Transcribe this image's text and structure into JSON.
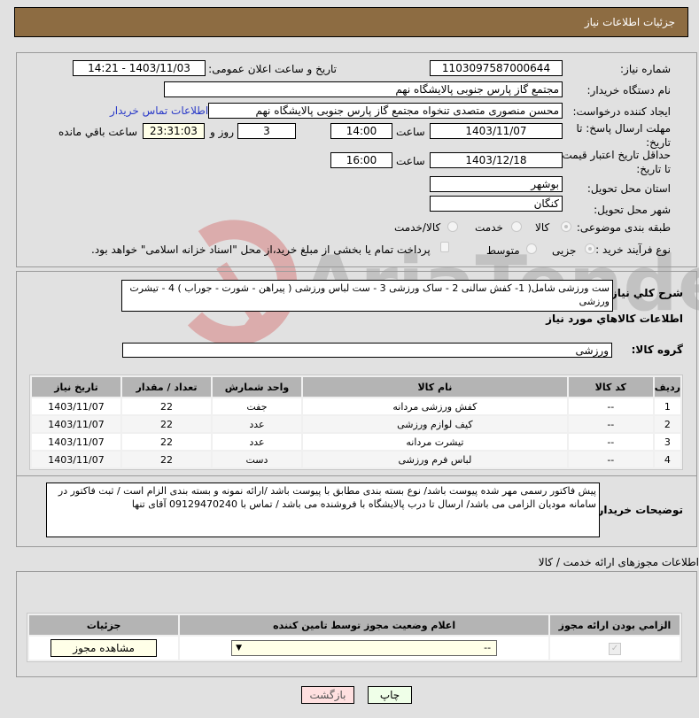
{
  "header": {
    "title": "جزئیات اطلاعات نیاز"
  },
  "form": {
    "need_number_label": "شماره نیاز:",
    "need_number": "1103097587000644",
    "announce_label": "تاریخ و ساعت اعلان عمومی:",
    "announce_value": "1403/11/03 - 14:21",
    "buyer_org_label": "نام دستگاه خریدار:",
    "buyer_org": "مجتمع گاز پارس جنوبی  پالایشگاه نهم",
    "creator_label": "ایجاد کننده درخواست:",
    "creator": "محسن منصوری متصدی تنخواه مجتمع گاز پارس جنوبی  پالایشگاه نهم",
    "contact_link": "اطلاعات تماس خریدار",
    "reply_deadline_label": "مهلت ارسال پاسخ: تا تاریخ:",
    "reply_date": "1403/11/07",
    "time_label": "ساعت",
    "reply_time": "14:00",
    "days_value": "3",
    "days_label": "روز و",
    "remaining_time": "23:31:03",
    "remaining_label": "ساعت باقي مانده",
    "price_validity_label": "حداقل تاریخ اعتبار قیمت: تا تاریخ:",
    "price_date": "1403/12/18",
    "price_time": "16:00",
    "province_label": "استان محل تحویل:",
    "province": "بوشهر",
    "city_label": "شهر محل تحویل:",
    "city": "کنگان",
    "category_label": "طبقه بندی موضوعی:",
    "category_options": [
      "کالا",
      "خدمت",
      "کالا/خدمت"
    ],
    "category_selected": "کالا",
    "process_label": "نوع فرآیند خرید :",
    "process_options": [
      "جزیی",
      "متوسط"
    ],
    "process_selected": "جزیی",
    "treasury_note": "پرداخت تمام یا بخشی از مبلغ خرید،از محل \"اسناد خزانه اسلامی\" خواهد بود."
  },
  "description": {
    "label": "شرح کلي نياز:",
    "value": "ست ورزشی شامل( 1- کفش سالنی 2 - ساک ورزشی 3 - ست لباس ورزشی ( پیراهن - شورت - جوراب ) 4 - تیشرت ورزشی"
  },
  "goods": {
    "section_title": "اطلاعات کالاهاي مورد نياز",
    "group_label": "گروه کالا:",
    "group_value": "ورزشی",
    "columns": [
      "ردیف",
      "کد کالا",
      "نام کالا",
      "واحد شمارش",
      "تعداد / مقدار",
      "تاریخ نیاز"
    ],
    "rows": [
      {
        "index": "1",
        "code": "--",
        "name": "کفش ورزشی مردانه",
        "unit": "جفت",
        "qty": "22",
        "date": "1403/11/07"
      },
      {
        "index": "2",
        "code": "--",
        "name": "کیف لوازم ورزشی",
        "unit": "عدد",
        "qty": "22",
        "date": "1403/11/07"
      },
      {
        "index": "3",
        "code": "--",
        "name": "تیشرت مردانه",
        "unit": "عدد",
        "qty": "22",
        "date": "1403/11/07"
      },
      {
        "index": "4",
        "code": "--",
        "name": "لباس فرم ورزشی",
        "unit": "دست",
        "qty": "22",
        "date": "1403/11/07"
      }
    ]
  },
  "buyer_notes": {
    "label": "توضیحات خریدار:",
    "value": "پیش فاکتور رسمی مهر شده پیوست باشد/ نوع بسته بندی مطابق با پیوست باشد /ارائه نمونه و بسته بندی الزام است / ثبت فاکتور در سامانه مودیان الزامی می باشد/ ارسال تا درب پالایشگاه با فروشنده می باشد / تماس با 09129470240 آقای تنها"
  },
  "permits": {
    "section_title": "اطلاعات مجوزهای ارائه خدمت / کالا",
    "columns": [
      "الزامي بودن ارائه مجوز",
      "اعلام وضعیت مجوز توسط تامین کننده",
      "جزئیات"
    ],
    "row": {
      "required_checked": true,
      "status_value": "--",
      "details_button": "مشاهده مجوز"
    }
  },
  "buttons": {
    "print": "چاپ",
    "back": "بازگشت"
  },
  "watermark": {
    "text": "AriaTender.neT"
  }
}
